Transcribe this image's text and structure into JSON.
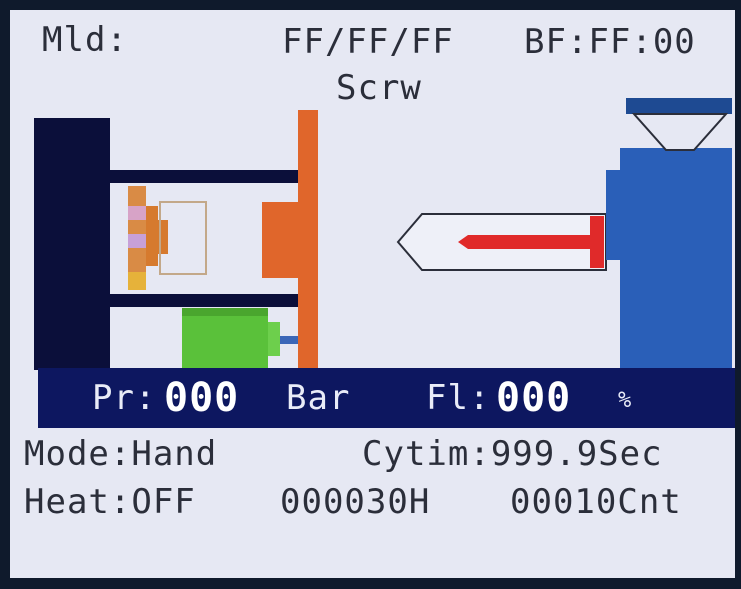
{
  "header": {
    "mold_label": "Mld:",
    "codes": "FF/FF/FF",
    "bf_label": "BF:FF:00",
    "mode_title": "Scrw"
  },
  "readout": {
    "pressure_label": "Pr:",
    "pressure_value": "000",
    "pressure_unit": "Bar",
    "flow_label": "Fl:",
    "flow_value": "000",
    "flow_unit": "%"
  },
  "status": {
    "mode": "Mode:Hand",
    "cycle_time": "Cytim:999.9Sec",
    "heat": "Heat:OFF",
    "hours": "000030H",
    "count": "00010Cnt"
  },
  "colors": {
    "screen_bg": "#e6e8f3",
    "bezel": "#0f1a2c",
    "readout_bar": "#0d1760",
    "platen_dark": "#0b0f3a",
    "platen_orange": "#e0662b",
    "motor_green": "#5ac13a",
    "barrel_blue": "#2a5fb8",
    "screw_red": "#e02a2a"
  },
  "icons": {
    "machine_diagram": "injection-molding-machine-icon"
  }
}
